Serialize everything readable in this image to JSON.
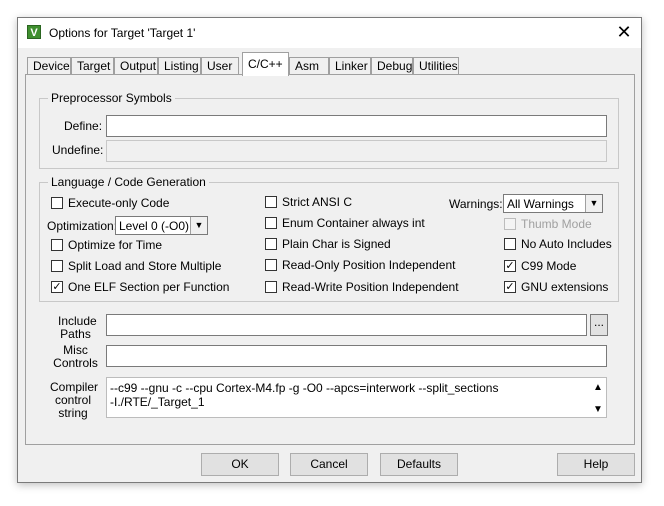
{
  "window": {
    "title": "Options for Target 'Target 1'",
    "icon": "app-icon",
    "close_glyph": "✕"
  },
  "tabs": [
    {
      "label": "Device"
    },
    {
      "label": "Target"
    },
    {
      "label": "Output"
    },
    {
      "label": "Listing"
    },
    {
      "label": "User"
    },
    {
      "label": "C/C++",
      "active": true
    },
    {
      "label": "Asm"
    },
    {
      "label": "Linker"
    },
    {
      "label": "Debug"
    },
    {
      "label": "Utilities"
    }
  ],
  "preprocessor": {
    "title": "Preprocessor Symbols",
    "define_label": "Define:",
    "define_value": "",
    "undefine_label": "Undefine:",
    "undefine_value": ""
  },
  "codegen": {
    "title": "Language / Code Generation",
    "execute_only": {
      "label": "Execute-only Code",
      "checked": false
    },
    "optimization_label": "Optimization:",
    "optimization_value": "Level 0 (-O0)",
    "optimize_time": {
      "label": "Optimize for Time",
      "checked": false
    },
    "split_load": {
      "label": "Split Load and Store Multiple",
      "checked": false
    },
    "one_elf": {
      "label": "One ELF Section per Function",
      "checked": true
    },
    "strict_ansi": {
      "label": "Strict ANSI C",
      "checked": false
    },
    "enum_int": {
      "label": "Enum Container always int",
      "checked": false
    },
    "plain_char": {
      "label": "Plain Char is Signed",
      "checked": false
    },
    "ro_pi": {
      "label": "Read-Only Position Independent",
      "checked": false
    },
    "rw_pi": {
      "label": "Read-Write Position Independent",
      "checked": false
    },
    "warnings_label": "Warnings:",
    "warnings_value": "All Warnings",
    "thumb_mode": {
      "label": "Thumb Mode",
      "checked": false,
      "disabled": true
    },
    "no_auto_includes": {
      "label": "No Auto Includes",
      "checked": false
    },
    "c99_mode": {
      "label": "C99 Mode",
      "checked": true
    },
    "gnu_ext": {
      "label": "GNU extensions",
      "checked": true
    }
  },
  "include": {
    "label_1": "Include",
    "label_2": "Paths",
    "value": "",
    "browse_label": "..."
  },
  "misc": {
    "label_1": "Misc",
    "label_2": "Controls",
    "value": ""
  },
  "compiler": {
    "label_1": "Compiler",
    "label_2": "control",
    "label_3": "string",
    "line_1": "--c99 --gnu -c --cpu Cortex-M4.fp -g -O0 --apcs=interwork --split_sections",
    "line_2": "-I./RTE/_Target_1"
  },
  "buttons": {
    "ok": "OK",
    "cancel": "Cancel",
    "defaults": "Defaults",
    "help": "Help"
  },
  "glyphs": {
    "check": "✓",
    "dropdown": "▼",
    "scroll_up": "▲",
    "scroll_down": "▼"
  }
}
